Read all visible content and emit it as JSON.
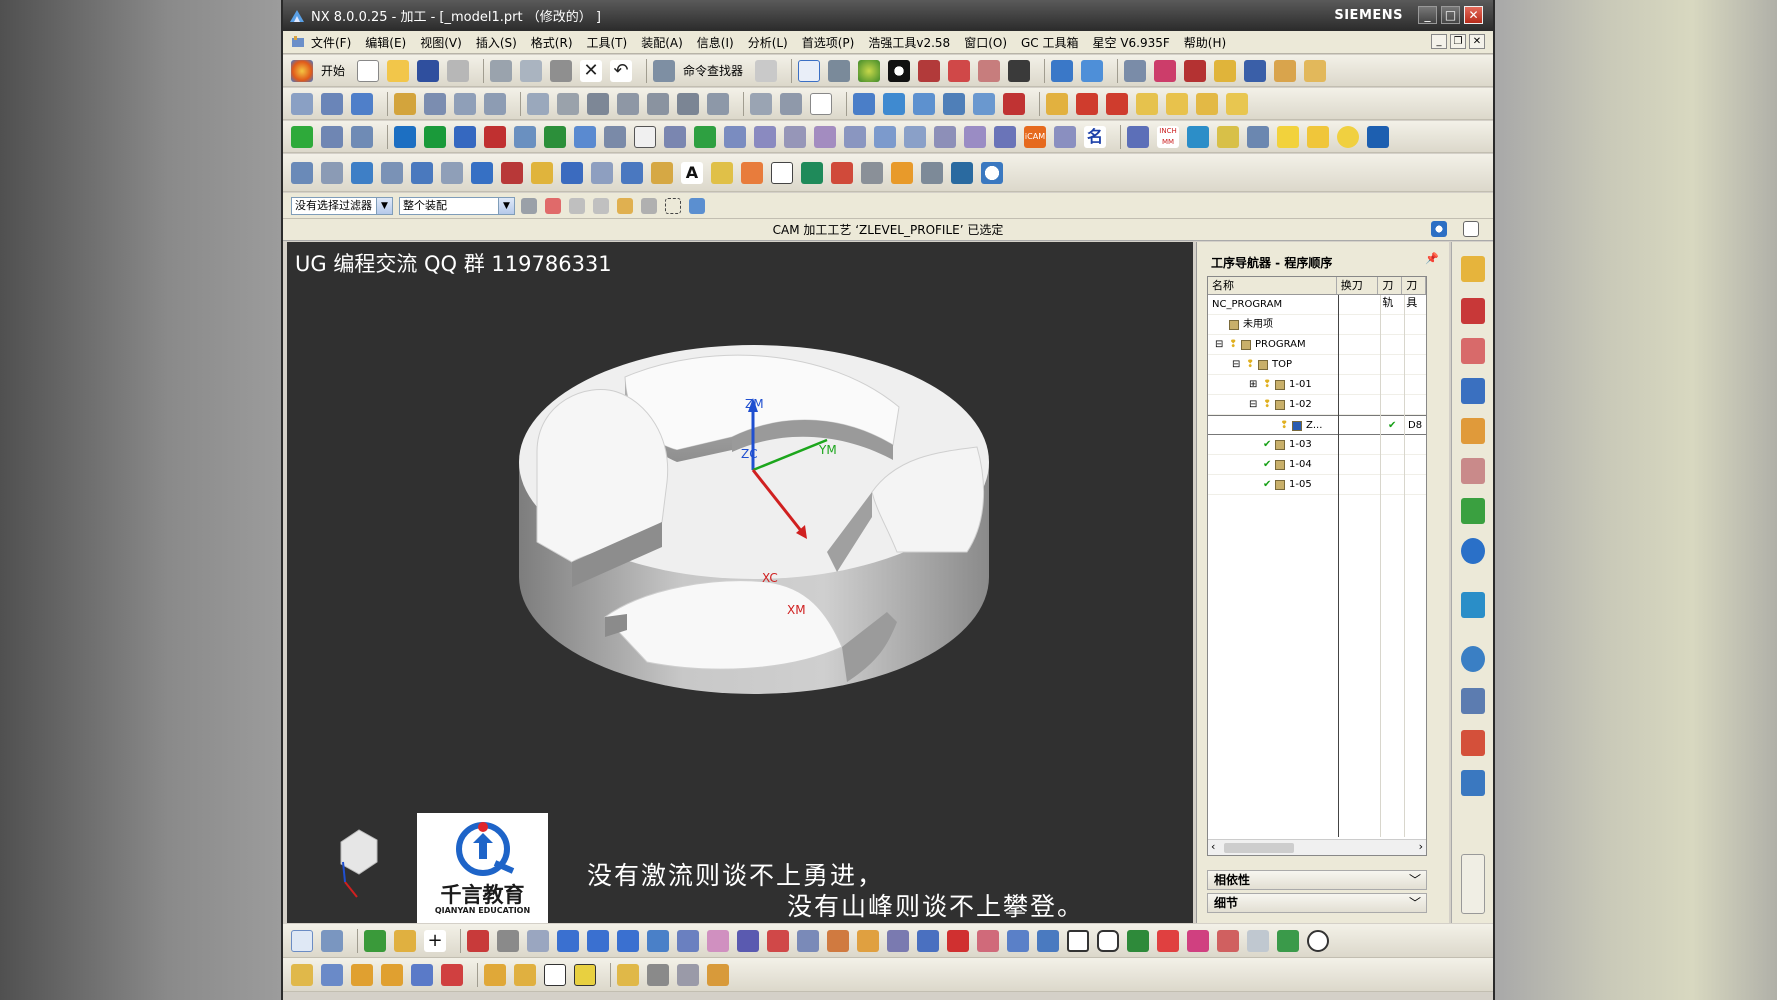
{
  "window": {
    "title": "NX 8.0.0.25 - 加工 - [_model1.prt （修改的） ]",
    "brand": "SIEMENS",
    "controls": [
      "_",
      "□",
      "✕"
    ]
  },
  "menu": {
    "items": [
      "文件(F)",
      "编辑(E)",
      "视图(V)",
      "插入(S)",
      "格式(R)",
      "工具(T)",
      "装配(A)",
      "信息(I)",
      "分析(L)",
      "首选项(P)",
      "浩强工具v2.58",
      "窗口(O)",
      "GC 工具箱",
      "星空 V6.935F",
      "帮助(H)"
    ]
  },
  "toolbar": {
    "start_label": "开始",
    "command_finder_label": "命令查找器"
  },
  "selection_bar": {
    "filter_value": "没有选择过滤器",
    "scope_value": "整个装配"
  },
  "status": {
    "message": "CAM 加工工艺 ‘ZLEVEL_PROFILE’ 已选定"
  },
  "viewport": {
    "watermark": "UG 编程交流 QQ 群 119786331",
    "axis_labels": {
      "zm": "ZM",
      "zc": "ZC",
      "ym": "YM",
      "xc": "XC",
      "xm": "XM"
    },
    "motto_line1": "没有激流则谈不上勇进，",
    "motto_line2": "没有山峰则谈不上攀登。",
    "logo_cn": "千言教育",
    "logo_en": "QIANYAN EDUCATION"
  },
  "navigator": {
    "title": "工序导航器 - 程序顺序",
    "columns": [
      "名称",
      "换刀",
      "刀轨",
      "刀具"
    ],
    "rows": [
      {
        "label": "NC_PROGRAM",
        "level": 0,
        "expander": "",
        "status": "",
        "toolpath": "",
        "tool": ""
      },
      {
        "label": "未用项",
        "level": 1,
        "expander": "",
        "status": "",
        "toolpath": "",
        "tool": ""
      },
      {
        "label": "PROGRAM",
        "level": 1,
        "expander": "⊟",
        "status": "pending",
        "toolpath": "",
        "tool": ""
      },
      {
        "label": "TOP",
        "level": 2,
        "expander": "⊟",
        "status": "pending",
        "toolpath": "",
        "tool": ""
      },
      {
        "label": "1-01",
        "level": 3,
        "expander": "⊞",
        "status": "pending",
        "toolpath": "",
        "tool": ""
      },
      {
        "label": "1-02",
        "level": 3,
        "expander": "⊟",
        "status": "pending",
        "toolpath": "",
        "tool": ""
      },
      {
        "label": "Z...",
        "level": 4,
        "expander": "",
        "status": "pending",
        "toolpath": "✔",
        "tool": "D8"
      },
      {
        "label": "1-03",
        "level": 3,
        "expander": "",
        "status": "done",
        "toolpath": "",
        "tool": ""
      },
      {
        "label": "1-04",
        "level": 3,
        "expander": "",
        "status": "done",
        "toolpath": "",
        "tool": ""
      },
      {
        "label": "1-05",
        "level": 3,
        "expander": "",
        "status": "done",
        "toolpath": "",
        "tool": ""
      }
    ],
    "dependency_label": "相依性",
    "details_label": "细节"
  },
  "colors": {
    "title_bar": "#2b2b2b",
    "viewport_bg": "#303030",
    "axis_z": "#1f4fd0",
    "axis_y": "#1ca61c",
    "axis_x": "#d02020",
    "check_green": "#18a018",
    "highlight_yellow": "#f5f500"
  }
}
